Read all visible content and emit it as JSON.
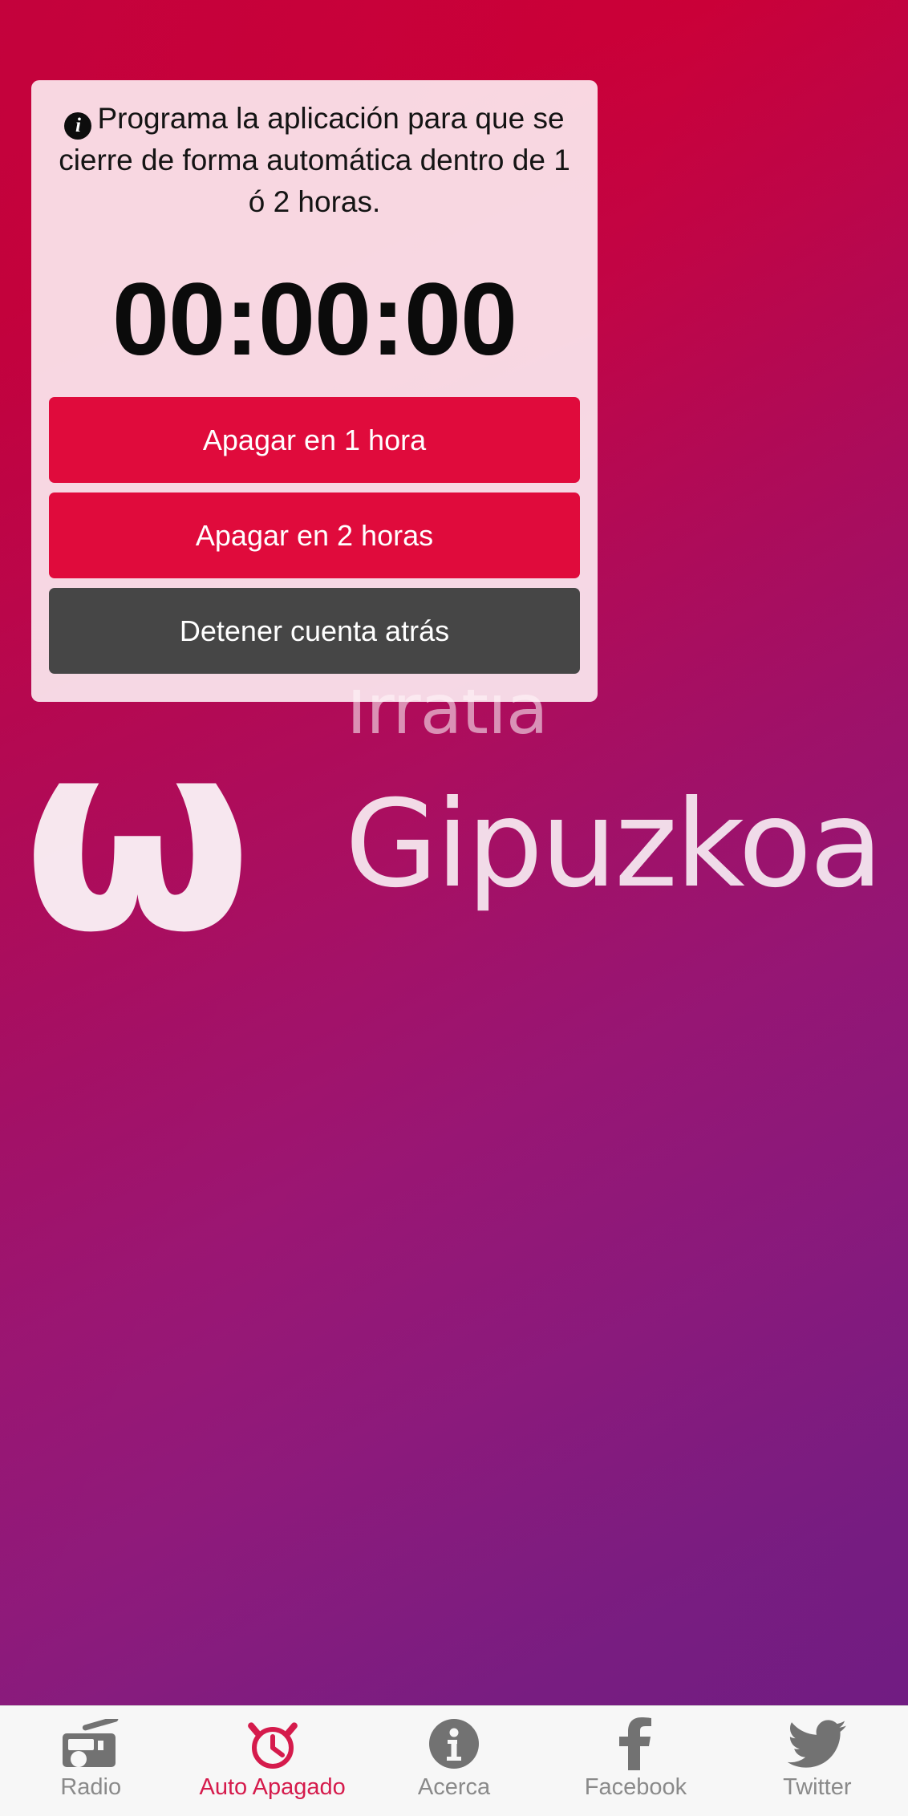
{
  "background": {
    "gradient_top": "#CE0036",
    "gradient_mid": "#9B1673",
    "gradient_bottom": "#721E82",
    "watermark_mark": "ω",
    "watermark_word": "Gipuzkoa",
    "watermark_sub": "Irratia"
  },
  "panel": {
    "info_icon": "info-icon",
    "info_text": "Programa la aplicación para que se cierre de forma automática dentro de 1 ó 2 horas.",
    "timer_value": "00:00:00",
    "buttons": [
      {
        "label": "Apagar en 1 hora",
        "color": "#E00B3C"
      },
      {
        "label": "Apagar en 2 horas",
        "color": "#E00B3C"
      },
      {
        "label": "Detener cuenta atrás",
        "color": "#464646"
      }
    ]
  },
  "tabbar": {
    "active_color": "#D51B4C",
    "inactive_color": "#8A8A8A",
    "items": [
      {
        "label": "Radio",
        "icon": "radio-icon",
        "active": false
      },
      {
        "label": "Auto Apagado",
        "icon": "alarm-clock-icon",
        "active": true
      },
      {
        "label": "Acerca",
        "icon": "info-circle-icon",
        "active": false
      },
      {
        "label": "Facebook",
        "icon": "facebook-icon",
        "active": false
      },
      {
        "label": "Twitter",
        "icon": "twitter-bird-icon",
        "active": false
      }
    ]
  }
}
